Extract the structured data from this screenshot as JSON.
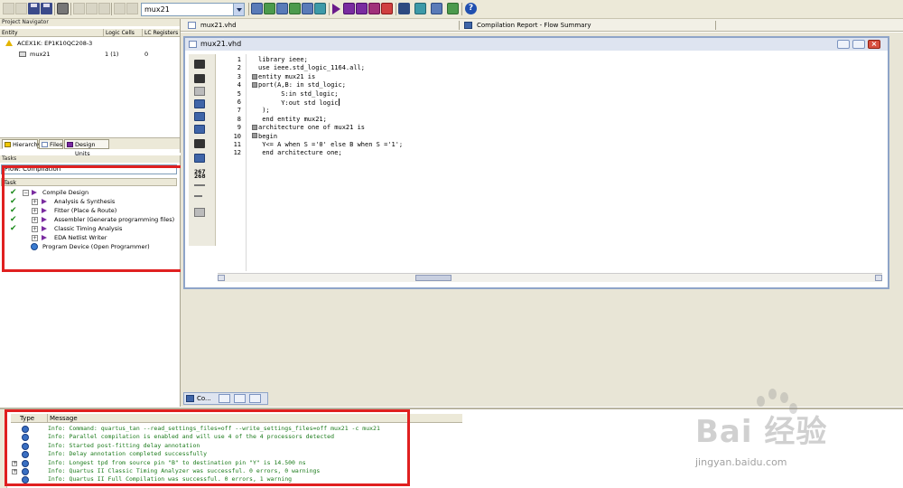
{
  "toolbar": {
    "combo_value": "mux21",
    "icons": [
      "new-file-icon",
      "open-icon",
      "save-icon",
      "save-all-icon",
      "print-icon",
      "cut-icon",
      "copy-icon",
      "paste-icon",
      "undo-icon",
      "redo-icon",
      "compile-icon",
      "analysis-icon",
      "fitter-icon",
      "assembler-icon",
      "timing-icon",
      "start-icon",
      "stop-icon",
      "run-icon",
      "simulation-icon",
      "programmer-icon",
      "chip-planner-icon",
      "rtl-viewer-icon",
      "help-icon"
    ]
  },
  "doc_tabs": [
    {
      "label": "mux21.vhd"
    },
    {
      "label": "Compilation Report - Flow Summary"
    }
  ],
  "project_navigator": {
    "title": "Project Navigator",
    "columns": {
      "entity": "Entity",
      "logic_cells": "Logic Cells",
      "lc_registers": "LC Registers"
    },
    "rows": [
      {
        "entity": "ACEX1K: EP1K10QC208-3",
        "logic_cells": "",
        "lc_registers": ""
      },
      {
        "entity": "mux21",
        "logic_cells": "1 (1)",
        "lc_registers": "0"
      }
    ],
    "tabs": [
      "Hierarchy",
      "Files",
      "Design Units"
    ]
  },
  "tasks": {
    "title": "Tasks",
    "flow_value": "Flow: Compilation",
    "header": "Task",
    "items": [
      {
        "label": "Compile Design",
        "done": true,
        "expanded": true
      },
      {
        "label": "Analysis & Synthesis",
        "done": true
      },
      {
        "label": "Fitter (Place & Route)",
        "done": true
      },
      {
        "label": "Assembler (Generate programming files)",
        "done": true
      },
      {
        "label": "Classic Timing Analysis",
        "done": true
      },
      {
        "label": "EDA Netlist Writer",
        "done": false
      },
      {
        "label": "Program Device (Open Programmer)",
        "done": false
      }
    ]
  },
  "editor": {
    "title": "mux21.vhd",
    "line_numbers": [
      "1",
      "2",
      "3",
      "4",
      "5",
      "6",
      "7",
      "8",
      "9",
      "10",
      "11",
      "12"
    ],
    "lines": [
      "library ieee;",
      "use ieee.std_logic_1164.all;",
      "entity mux21 is",
      "port(A,B: in std_logic;",
      "      S:in std_logic;",
      "      Y:out std logic",
      " );",
      " end entity mux21;",
      "architecture one of mux21 is",
      "begin",
      " Y<= A when S ='0' else B when S ='1';",
      " end architecture one;"
    ]
  },
  "min_window": {
    "label": "Co..."
  },
  "messages": {
    "columns": {
      "type": "Type",
      "message": "Message"
    },
    "rows": [
      "Info: Command: quartus_tan --read_settings_files=off --write_settings_files=off mux21 -c mux21",
      "Info: Parallel compilation is enabled and will use 4 of the 4 processors detected",
      "Info: Started post-fitting delay annotation",
      "Info: Delay annotation completed successfully",
      "Info: Longest tpd from source pin \"B\" to destination pin \"Y\" is 14.500 ns",
      "Info: Quartus II Classic Timing Analyzer was successful. 0 errors, 0 warnings",
      "Info: Quartus II Full Compilation was successful. 0 errors, 1 warning"
    ]
  },
  "watermark": {
    "text": "Bai 经验",
    "url": "jingyan.baidu.com"
  },
  "colors": {
    "highlight": "#e02020",
    "success": "#1b8a1b",
    "info_text": "#1a7a1a"
  }
}
